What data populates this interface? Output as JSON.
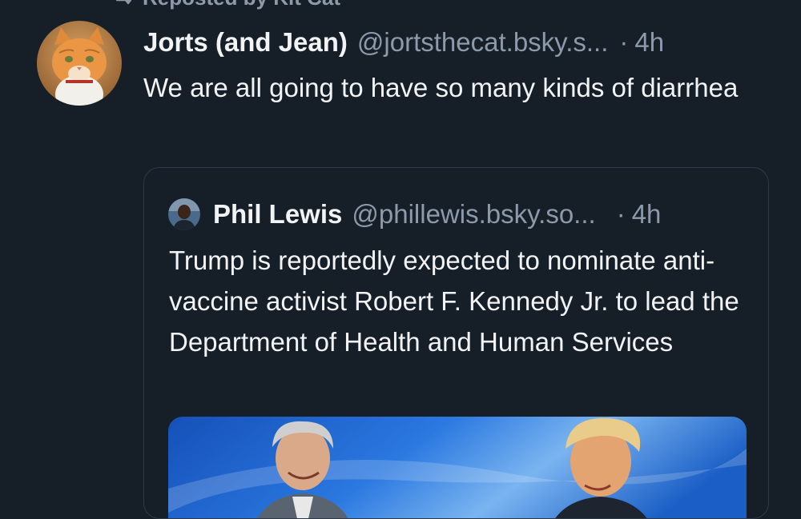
{
  "repost": {
    "label": "Reposted by Kit Cat"
  },
  "post": {
    "author_name": "Jorts (and Jean)",
    "author_handle": "@jortsthecat.bsky.s...",
    "separator": "·",
    "time": "4h",
    "text": "We are all going to have so many kinds of diarrhea",
    "avatar_icon": "orange-cat-avatar"
  },
  "quote": {
    "author_name": "Phil Lewis",
    "author_handle": "@phillewis.bsky.so...",
    "separator": "·",
    "time": "4h",
    "text": "Trump is reportedly expected to nominate anti-vaccine activist Robert F. Kennedy Jr. to lead the Department of Health and Human Services",
    "avatar_icon": "person-avatar",
    "image_icon": "news-photo-two-men"
  },
  "colors": {
    "background": "#161e27",
    "text_primary": "#f1f3f5",
    "text_secondary": "#8c9aab",
    "card_border": "#2e3a48",
    "image_blue": "#1d63c9"
  }
}
